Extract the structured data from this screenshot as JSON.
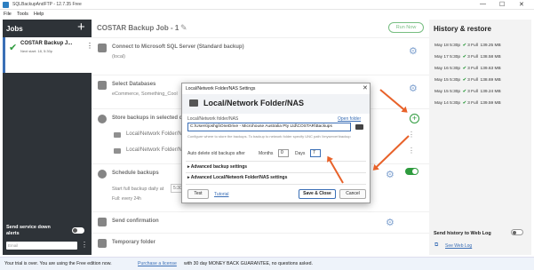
{
  "window": {
    "title": "SQLBackupAndFTP - 12.7.35 Free",
    "controls": [
      "—",
      "☐",
      "✕"
    ]
  },
  "menu": [
    "File",
    "Tools",
    "Help"
  ],
  "sidebar": {
    "header": "Jobs",
    "add_icon": "+",
    "job": {
      "name": "COSTAR Backup J...",
      "sub": "Next start: 18, 5:30p"
    },
    "alerts_label": "Send service down alerts",
    "email_placeholder": "Email"
  },
  "main": {
    "job_title": "COSTAR Backup Job - 1",
    "run_now": "Run Now",
    "sections": {
      "connect": {
        "title": "Connect to Microsoft SQL Server (Standard backup)",
        "sub": "(local)"
      },
      "databases": {
        "title": "Select Databases",
        "sub": "eCommerce, Something_Cool"
      },
      "store": {
        "title": "Store backups in selected des",
        "rows": [
          "Local/Network Folder/NAS",
          "Local/Network Folder/NAS"
        ]
      },
      "schedule": {
        "title": "Schedule backups",
        "sub1": "Start full backup daily at",
        "time": "5:30",
        "sub2": "Full: every 24h"
      },
      "confirm": {
        "title": "Send confirmation"
      },
      "temp": {
        "title": "Temporary folder"
      }
    }
  },
  "dialog": {
    "window_title": "Local/Network Folder/NAS Settings",
    "heading": "Local/Network Folder/NAS",
    "field_label": "Local/Network folder/NAS",
    "open_folder": "Open folder",
    "path_value": "C:\\Users\\joshgi\\OneDrive - Microhouse Australia Pty Ltd\\COSTAR\\Backups",
    "help_text": "Configure where to store the backups. To backup to network folder specify UNC path \\\\myserver\\backup",
    "auto_delete": "Auto delete old backups after",
    "months_label": "Months",
    "months_value": "0",
    "days_label": "Days",
    "days_value": "7",
    "adv_backup": "Advanced backup settings",
    "adv_nas": "Advanced Local/Network Folder/NAS settings",
    "test": "Test",
    "tutorial": "Tutorial",
    "save_close": "Save & Close",
    "cancel": "Cancel"
  },
  "history": {
    "title": "History & restore",
    "rows": [
      {
        "date": "May 18 5:30p",
        "status": "3 Full",
        "size": "139.25 MB"
      },
      {
        "date": "May 17 5:30p",
        "status": "3 Full",
        "size": "138.58 MB"
      },
      {
        "date": "May 16 5:30p",
        "status": "3 Full",
        "size": "139.63 MB"
      },
      {
        "date": "May 15 5:30p",
        "status": "3 Full",
        "size": "138.69 MB"
      },
      {
        "date": "May 15 5:30p",
        "status": "3 Full",
        "size": "139.24 MB"
      },
      {
        "date": "May 14 5:30p",
        "status": "3 Full",
        "size": "139.59 MB"
      }
    ],
    "send_web": "Send history to Web Log",
    "view_web": "See Web Log"
  },
  "footer": {
    "trial": "Your trial is over. You are using the Free edition now.",
    "purchase": "Purchase a license",
    "rest": "with 30 day MONEY BACK GUARANTEE, no questions asked."
  },
  "colors": {
    "accent": "#3b6fb6",
    "success": "#2e9b3e",
    "arrow": "#e8622a",
    "sidebar": "#2e3338"
  }
}
